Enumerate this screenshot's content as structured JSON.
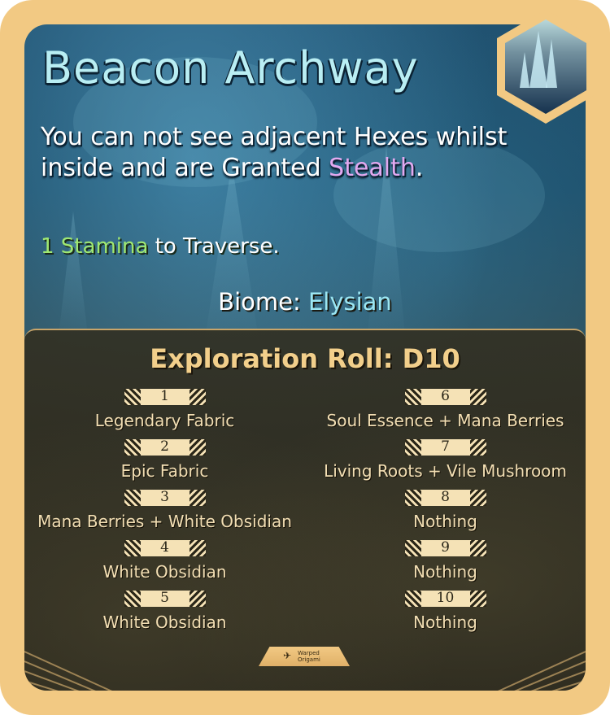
{
  "card": {
    "title": "Beacon Archway",
    "description_pre": "You can not see adjacent Hexes whilst inside and are Granted ",
    "description_highlight": "Stealth",
    "description_post": ".",
    "cost_highlight": "1 Stamina",
    "cost_text": " to Traverse.",
    "biome_label": "Biome: ",
    "biome_value": "Elysian",
    "roll_title": "Exploration Roll: D10",
    "publisher": {
      "line1": "Warped",
      "line2": "Origami"
    }
  },
  "exploration": {
    "left": [
      {
        "num": "1",
        "item": "Legendary Fabric"
      },
      {
        "num": "2",
        "item": "Epic Fabric"
      },
      {
        "num": "3",
        "item": "Mana Berries + White Obsidian"
      },
      {
        "num": "4",
        "item": "White Obsidian"
      },
      {
        "num": "5",
        "item": "White Obsidian"
      }
    ],
    "right": [
      {
        "num": "6",
        "item": "Soul Essence + Mana Berries"
      },
      {
        "num": "7",
        "item": "Living Roots + Vile Mushroom"
      },
      {
        "num": "8",
        "item": "Nothing"
      },
      {
        "num": "9",
        "item": "Nothing"
      },
      {
        "num": "10",
        "item": "Nothing"
      }
    ]
  },
  "colors": {
    "frame": "#f2c983",
    "title": "#b9eef3",
    "stealth": "#e2a9f0",
    "stamina": "#9fe872",
    "biome": "#9be6f2",
    "roll_title": "#f2cf8b",
    "item_text": "#f3dfb4"
  },
  "icons": {
    "hex_emblem": "elysian-spires-hex-icon",
    "publisher_logo": "origami-crane-icon"
  }
}
